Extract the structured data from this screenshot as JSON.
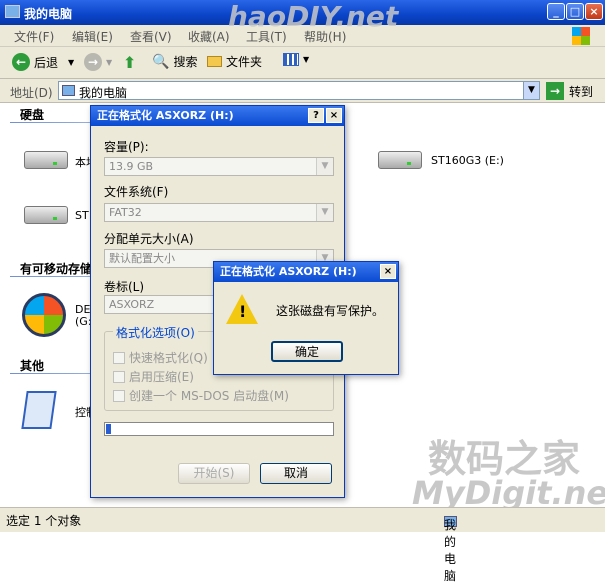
{
  "window": {
    "title": "我的电脑",
    "min": "_",
    "max": "□",
    "close": "×"
  },
  "menu": [
    "文件(F)",
    "编辑(E)",
    "查看(V)",
    "收藏(A)",
    "工具(T)",
    "帮助(H)"
  ],
  "toolbar": {
    "back": "后退",
    "search": "搜索",
    "folders": "文件夹"
  },
  "address": {
    "label": "地址(D)",
    "value": "我的电脑",
    "go": "转到"
  },
  "sections": {
    "hard": "硬盘",
    "removable": "有可移动存储",
    "other": "其他"
  },
  "drives": {
    "c": "本地",
    "st1": "ST1",
    "e": "ST160G3 (E:)",
    "dvd1": "DE",
    "dvd2": "(G:",
    "ctrl": "控制"
  },
  "format_dialog": {
    "title": "正在格式化 ASXORZ (H:)",
    "help": "?",
    "close": "×",
    "capacity_label": "容量(P):",
    "capacity_value": "13.9 GB",
    "fs_label": "文件系统(F)",
    "fs_value": "FAT32",
    "alloc_label": "分配单元大小(A)",
    "alloc_value": "默认配置大小",
    "vol_label": "卷标(L)",
    "vol_value": "ASXORZ",
    "options_legend": "格式化选项(O)",
    "opt_quick": "快速格式化(Q)",
    "opt_compress": "启用压缩(E)",
    "opt_msdos": "创建一个 MS-DOS 启动盘(M)",
    "progress": 0.02,
    "start": "开始(S)",
    "cancel": "取消"
  },
  "warning_dialog": {
    "title": "正在格式化 ASXORZ (H:)",
    "close": "×",
    "message": "这张磁盘有写保护。",
    "ok": "确定",
    "icon_glyph": "!"
  },
  "status": {
    "left": "选定 1 个对象",
    "right": "我的电脑"
  },
  "watermarks": {
    "top": "haoDIY.net",
    "brand": "数码之家",
    "url": "MyDigit.net"
  }
}
